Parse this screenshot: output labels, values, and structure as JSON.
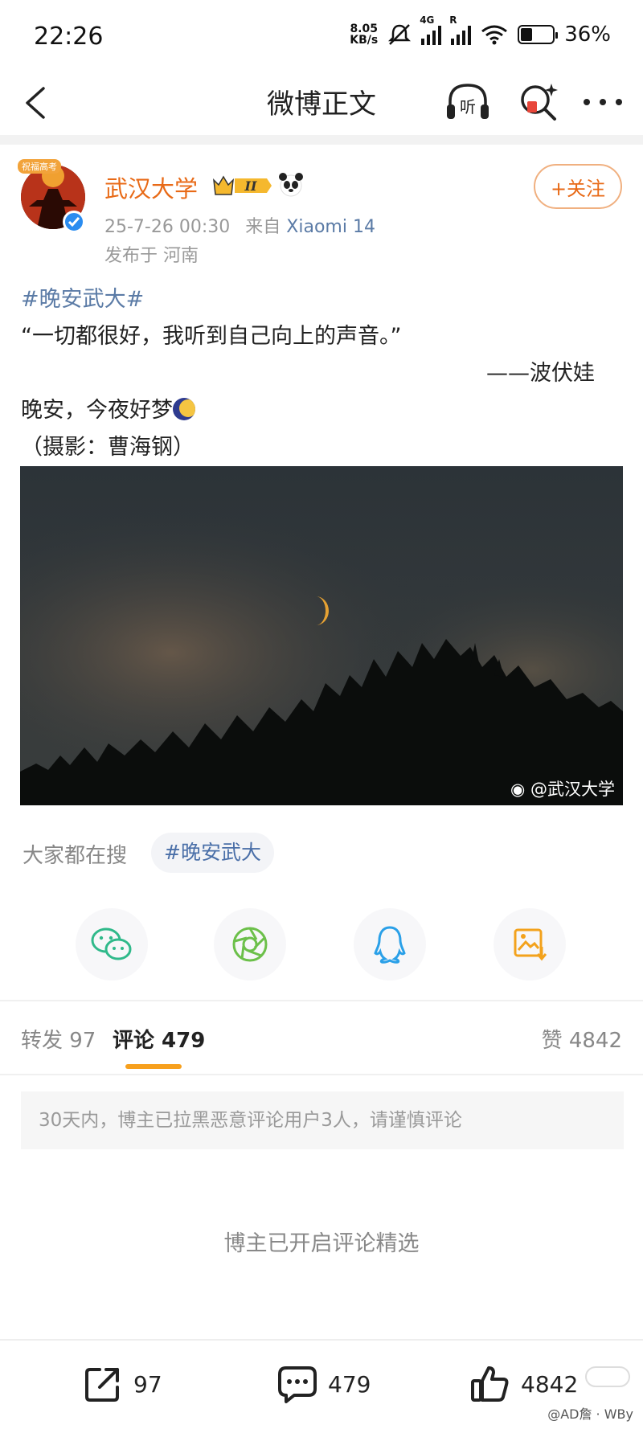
{
  "status_bar": {
    "time": "22:26",
    "net_speed_value": "8.05",
    "net_speed_unit": "KB/s",
    "network_type": "4G",
    "roaming_mark": "R",
    "battery_level": 0.36,
    "battery_text": "36%",
    "icons": [
      "mute-icon",
      "signal-icon",
      "signal-icon",
      "wifi-icon",
      "battery-icon"
    ]
  },
  "nav": {
    "title": "微博正文",
    "listen_label": "听",
    "icons": [
      "back-icon",
      "listen-icon",
      "search-icon",
      "more-icon"
    ]
  },
  "post": {
    "author": "武汉大学",
    "avatar_tag": "祝福高考",
    "date": "25-7-26 00:30",
    "from_label": "来自",
    "device": "Xiaomi 14",
    "location": "发布于 河南",
    "follow_label": "+关注",
    "vip_level": "II",
    "lines": {
      "hashtag": "#晚安武大#",
      "quote": "“一切都很好，我听到自己向上的声音。”",
      "attribution": "——波伏娃",
      "goodnight": "晚安，今夜好梦",
      "photo_credit": "（摄影：曹海钢）"
    },
    "image_watermark": "@武汉大学"
  },
  "search": {
    "label": "大家都在搜",
    "chip": "#晚安武大"
  },
  "share": [
    "wechat-icon",
    "moments-icon",
    "qq-icon",
    "save-image-icon"
  ],
  "tabs": {
    "repost": "转发 97",
    "comments": "评论 479",
    "likes": "赞 4842"
  },
  "notice": "30天内，博主已拉黑恶意评论用户3人，请谨慎评论",
  "selected_comments_note": "博主已开启评论精选",
  "bottom_bar": {
    "repost_count": "97",
    "comment_count": "479",
    "like_count": "4842"
  },
  "corner_watermark": "@AD詹 · WBy",
  "colors": {
    "accent_orange": "#e86a17",
    "link_blue": "#5b7ba6",
    "tab_indicator": "#f7a01d"
  }
}
